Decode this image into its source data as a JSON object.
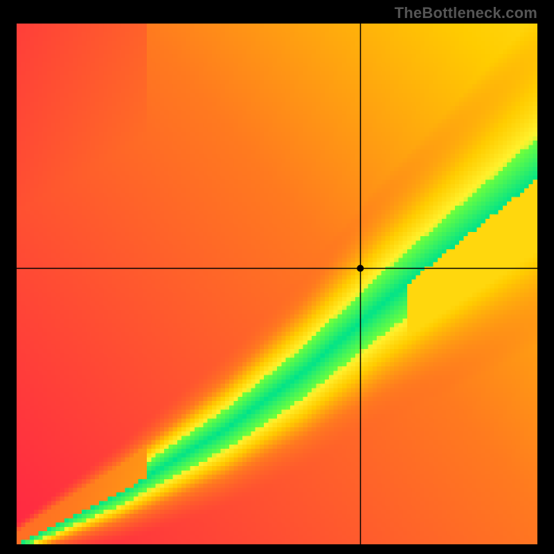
{
  "watermark": "TheBottleneck.com",
  "chart_data": {
    "type": "heatmap",
    "title": "",
    "xlabel": "",
    "ylabel": "",
    "xlim": [
      0,
      1
    ],
    "ylim": [
      0,
      1
    ],
    "grid_resolution": 120,
    "crosshair": {
      "x": 0.66,
      "y": 0.53
    },
    "marker": {
      "x": 0.66,
      "y": 0.53,
      "radius": 5
    },
    "optimal_anchors": [
      {
        "x": 0.0,
        "y": 0.0
      },
      {
        "x": 0.2,
        "y": 0.1
      },
      {
        "x": 0.4,
        "y": 0.22
      },
      {
        "x": 0.55,
        "y": 0.33
      },
      {
        "x": 0.7,
        "y": 0.46
      },
      {
        "x": 0.85,
        "y": 0.58
      },
      {
        "x": 1.0,
        "y": 0.7
      }
    ],
    "band": {
      "width_at_0": 0.02,
      "width_at_1": 0.16
    },
    "score_colors": [
      {
        "t": 0.0,
        "hex": "#ff1a49"
      },
      {
        "t": 0.4,
        "hex": "#ff7a1f"
      },
      {
        "t": 0.6,
        "hex": "#ffcc00"
      },
      {
        "t": 0.78,
        "hex": "#fff22e"
      },
      {
        "t": 0.92,
        "hex": "#6eff3c"
      },
      {
        "t": 1.0,
        "hex": "#00e389"
      }
    ],
    "pixelate": true
  }
}
